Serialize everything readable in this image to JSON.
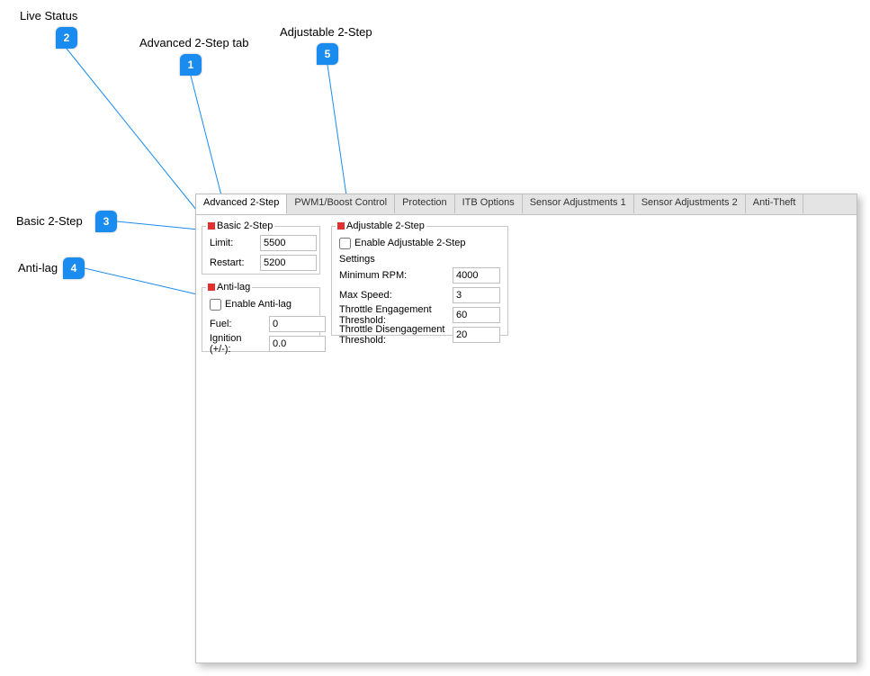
{
  "callouts": {
    "c1": {
      "label": "Advanced 2-Step tab",
      "num": "1"
    },
    "c2": {
      "label": "Live Status",
      "num": "2"
    },
    "c3": {
      "label": "Basic 2-Step",
      "num": "3"
    },
    "c4": {
      "label": "Anti-lag",
      "num": "4"
    },
    "c5": {
      "label": "Adjustable 2-Step",
      "num": "5"
    }
  },
  "tabs": [
    "Advanced 2-Step",
    "PWM1/Boost Control",
    "Protection",
    "ITB Options",
    "Sensor Adjustments 1",
    "Sensor Adjustments 2",
    "Anti-Theft"
  ],
  "basic2step": {
    "legend": "Basic 2-Step",
    "limit_label": "Limit:",
    "limit": "5500",
    "restart_label": "Restart:",
    "restart": "5200"
  },
  "antilag": {
    "legend": "Anti-lag",
    "enable_label": "Enable Anti-lag",
    "fuel_label": "Fuel:",
    "fuel": "0",
    "ign_label": "Ignition (+/-):",
    "ign": "0.0"
  },
  "adj2step": {
    "legend": "Adjustable 2-Step",
    "enable_label": "Enable Adjustable 2-Step",
    "settings_label": "Settings",
    "min_rpm_label": "Minimum RPM:",
    "min_rpm": "4000",
    "max_speed_label": "Max Speed:",
    "max_speed": "3",
    "eng_label": "Throttle Engagement Threshold:",
    "eng": "60",
    "dis_label": "Throttle Disengagement Threshold:",
    "dis": "20"
  }
}
